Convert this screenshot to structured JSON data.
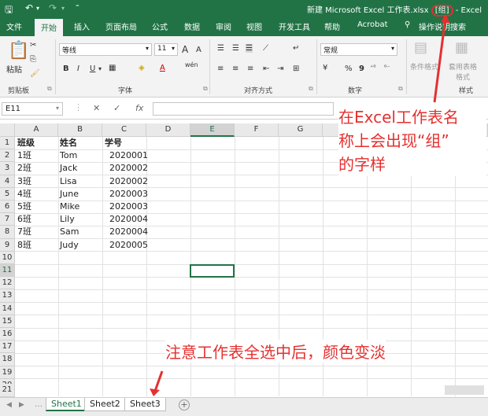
{
  "title_bar": {
    "filename": "新建 Microsoft Excel 工作表.xlsx",
    "group_tag": "[组]",
    "app": "- Excel",
    "quick_access": [
      "save-icon",
      "undo-icon",
      "redo-icon",
      "customize-icon"
    ]
  },
  "tabs": [
    "文件",
    "开始",
    "插入",
    "页面布局",
    "公式",
    "数据",
    "审阅",
    "视图",
    "开发工具",
    "帮助",
    "Acrobat",
    "操作说明搜索"
  ],
  "ribbon": {
    "clipboard": {
      "paste": "粘贴",
      "label": "剪贴板"
    },
    "font": {
      "name": "等线",
      "size": "11",
      "grow": "A",
      "shrink": "A",
      "bold": "B",
      "italic": "I",
      "underline": "U",
      "wen": "wén",
      "label": "字体"
    },
    "alignment": {
      "label": "对齐方式"
    },
    "number": {
      "format": "常规",
      "percent": "%",
      "comma": "9",
      "label": "数字"
    },
    "styles": {
      "conditional": "条件格式",
      "table": "套用表格格式",
      "label": "样式"
    }
  },
  "formula_bar": {
    "name_box": "E11",
    "fx": "fx",
    "cancel": "✕",
    "enter": "✓",
    "value": ""
  },
  "columns": [
    "A",
    "B",
    "C",
    "D",
    "E",
    "F",
    "G",
    "H",
    "I",
    "J",
    "K"
  ],
  "rows": [
    "1",
    "2",
    "3",
    "4",
    "5",
    "6",
    "7",
    "8",
    "9",
    "10",
    "11",
    "12",
    "13",
    "14",
    "15",
    "16",
    "17",
    "18",
    "19",
    "20",
    "21"
  ],
  "sheet": {
    "headers": [
      "班级",
      "姓名",
      "学号"
    ],
    "data": [
      [
        "1班",
        "Tom",
        "2020001"
      ],
      [
        "2班",
        "Jack",
        "2020002"
      ],
      [
        "3班",
        "Lisa",
        "2020002"
      ],
      [
        "4班",
        "June",
        "2020003"
      ],
      [
        "5班",
        "Mike",
        "2020003"
      ],
      [
        "6班",
        "Lily",
        "2020004"
      ],
      [
        "7班",
        "Sam",
        "2020004"
      ],
      [
        "8班",
        "Judy",
        "2020005"
      ]
    ]
  },
  "sheet_tabs": [
    "Sheet1",
    "Sheet2",
    "Sheet3"
  ],
  "annotations": {
    "top_line1": "在Excel工作表名",
    "top_line2": "称上会出现“组”",
    "top_line3": "的字样",
    "bottom": "注意工作表全选中后，颜色变淡"
  }
}
